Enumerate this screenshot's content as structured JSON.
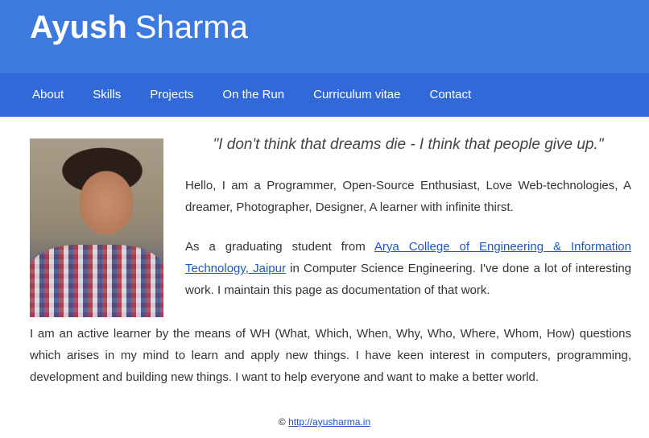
{
  "header": {
    "first_name": "Ayush",
    "last_name": "Sharma"
  },
  "nav": {
    "items": [
      "About",
      "Skills",
      "Projects",
      "On the Run",
      "Curriculum vitae",
      "Contact"
    ]
  },
  "main": {
    "quote": "\"I don't think that dreams die - I think that people give up.\"",
    "intro": "Hello, I am a Programmer, Open-Source Enthusiast, Love Web-technologies, A dreamer, Photographer, Designer, A learner with infinite thirst.",
    "para2_before": "As a graduating student from ",
    "college_link": "Arya College of Engineering & Information Technology, Jaipur",
    "para2_after": " in Computer Science Engineering. I've done a lot of interesting work. I maintain this page as documentation of that work.",
    "para3": "I am an active learner by the means of WH (What, Which, When, Why, Who, Where, Whom, How) questions which arises in my mind to learn and apply new things. I have keen interest in computers, programming, development and building new things. I want to help everyone and want to make a better world."
  },
  "footer": {
    "copyright": "©",
    "link": "http://ayusharma.in"
  },
  "colors": {
    "header_bg": "#3c7ae0",
    "nav_bg": "#3269d8",
    "link": "#1a56c8"
  }
}
